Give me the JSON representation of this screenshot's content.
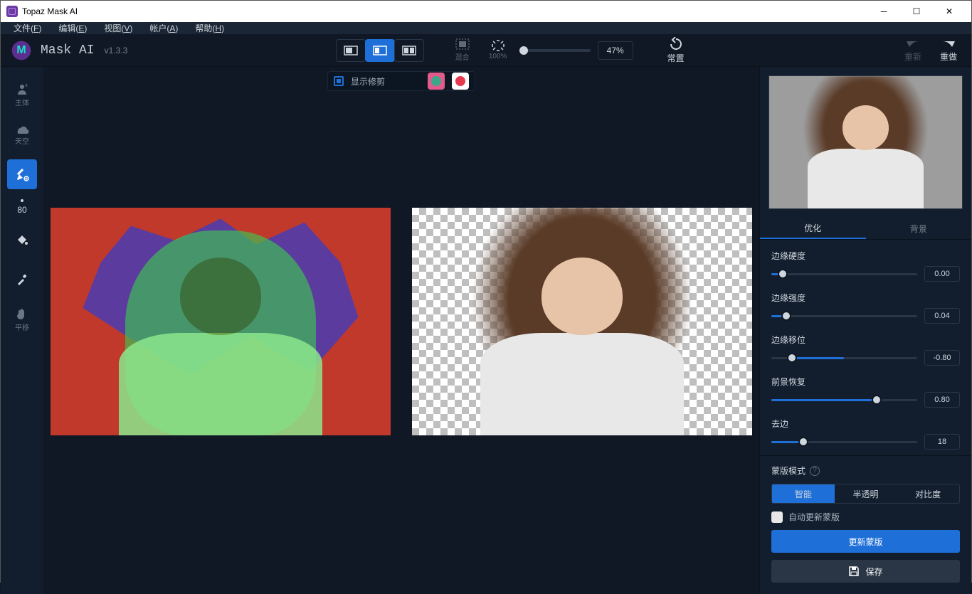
{
  "title": "Topaz Mask AI",
  "menu": {
    "file": "文件(F)",
    "edit": "编辑(E)",
    "view": "视图(V)",
    "account": "帐户(A)",
    "help": "帮助(H)"
  },
  "brand": {
    "name": "Mask AI",
    "version": "v1.3.3"
  },
  "topbar": {
    "merge_label": "混合",
    "zoom100_label": "100%",
    "zoom_readout": "47%",
    "reset_label": "常置",
    "undo_label": "重新",
    "redo_label": "重做"
  },
  "overlay": {
    "show_crop": "显示修剪"
  },
  "tools": {
    "subject": "主体",
    "sky": "天空",
    "brush_size": "80",
    "pan": "平移"
  },
  "right": {
    "tabs": {
      "optimize": "优化",
      "background": "背景"
    },
    "sliders": [
      {
        "label": "边缘硬度",
        "value": "0.00",
        "pct": 8
      },
      {
        "label": "边缘强度",
        "value": "0.04",
        "pct": 10
      },
      {
        "label": "边缘移位",
        "value": "-0.80",
        "pct": 14
      },
      {
        "label": "前景恢复",
        "value": "0.80",
        "pct": 72
      },
      {
        "label": "去边",
        "value": "18",
        "pct": 22
      }
    ],
    "mask_mode_title": "蒙版模式",
    "seg": {
      "smart": "智能",
      "semi": "半透明",
      "contrast": "对比度"
    },
    "auto_update": "自动更新蒙版",
    "update_btn": "更新蒙版",
    "save_btn": "保存"
  }
}
